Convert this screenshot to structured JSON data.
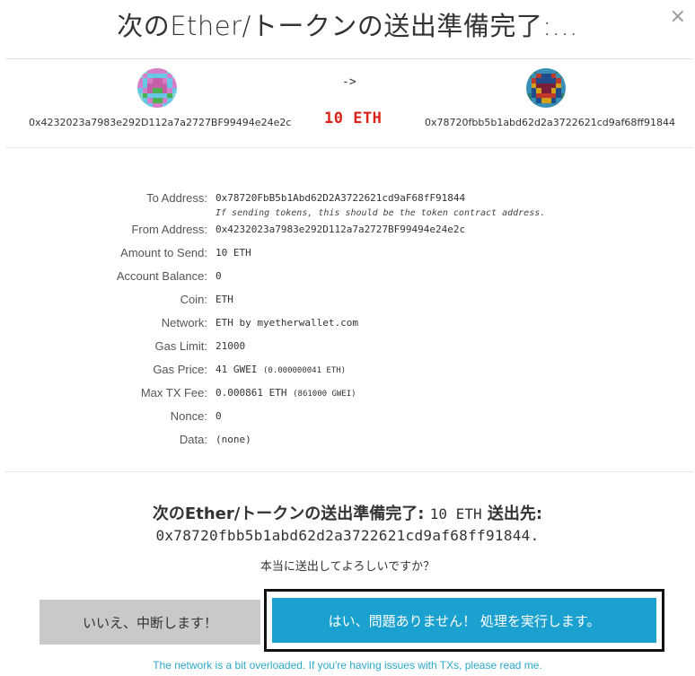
{
  "modal": {
    "title": "次のEther/トークンの送出準備完了:...",
    "close_symbol": "×"
  },
  "summary": {
    "from_address": "0x4232023a7983e292D112a7a2727BF99494e24e2c",
    "to_address": "0x78720fbb5b1abd62d2a3722621cd9af68ff91844",
    "arrow": "->",
    "amount": "10 ETH"
  },
  "details": [
    {
      "label": "To Address:",
      "value": "0x78720FbB5b1Abd62D2A3722621cd9aF68fF91844",
      "hint": "If sending tokens, this should be the token contract address."
    },
    {
      "label": "From Address:",
      "value": "0x4232023a7983e292D112a7a2727BF99494e24e2c"
    },
    {
      "label": "Amount to Send:",
      "value": "10 ETH"
    },
    {
      "label": "Account Balance:",
      "value": "0"
    },
    {
      "label": "Coin:",
      "value": "ETH"
    },
    {
      "label": "Network:",
      "value": "ETH by myetherwallet.com"
    },
    {
      "label": "Gas Limit:",
      "value": "21000"
    },
    {
      "label": "Gas Price:",
      "value": "41 GWEI",
      "sub": "(0.000000041 ETH)"
    },
    {
      "label": "Max TX Fee:",
      "value": "0.000861 ETH",
      "sub": "(861000 GWEI)"
    },
    {
      "label": "Nonce:",
      "value": "0"
    },
    {
      "label": "Data:",
      "value": "(none)"
    }
  ],
  "confirm": {
    "lead": "次のEther/トークンの送出準備完了:",
    "amount": "10 ETH",
    "to_label": "送出先:",
    "address": "0x78720fbb5b1abd62d2a3722621cd9af68ff91844.",
    "question": "本当に送出してよろしいですか？"
  },
  "buttons": {
    "no": "いいえ、中断します！",
    "yes": "はい、問題ありません！ 処理を実行します。"
  },
  "footer": {
    "link": "The network is a bit overloaded. If you're having issues with TXs, please read me."
  },
  "colors": {
    "amount_red": "#d9231a",
    "primary_blue": "#1ba1d0",
    "link_blue": "#2da8c8",
    "cancel_gray": "#c9c9c9"
  }
}
